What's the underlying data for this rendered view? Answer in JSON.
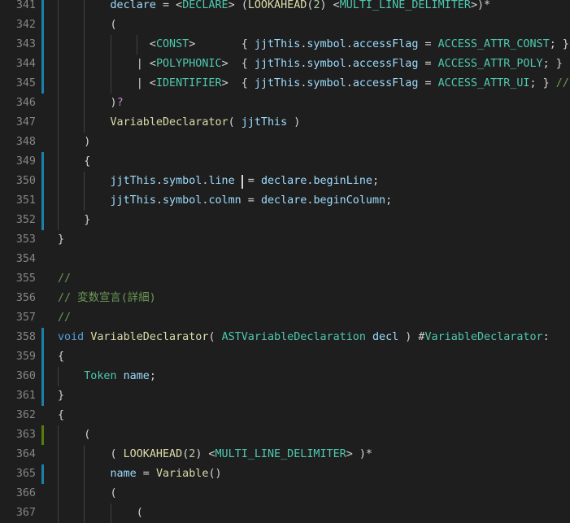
{
  "editor": {
    "theme": {
      "background": "#1e1e1e",
      "line_number": "#858585",
      "gutter_modified": "#1b81a8",
      "gutter_added": "#587c0c",
      "indent_guide": "#404040",
      "cursor": "#d4d4d4"
    },
    "token_colors": {
      "k": "#569cd6",
      "f": "#dcdcaa",
      "t": "#4ec9b0",
      "v": "#9cdcfe",
      "c": "#6a9955",
      "n": "#b5cea8",
      "p": "#d4d4d4",
      "m": "#c586c0"
    },
    "lines": [
      {
        "num": "341",
        "gutter": "mod",
        "segs": [
          [
            "p",
            "        "
          ],
          [
            "v",
            "declare"
          ],
          [
            "p",
            " = <"
          ],
          [
            "t",
            "DECLARE"
          ],
          [
            "p",
            "> ("
          ],
          [
            "f",
            "LOOKAHEAD"
          ],
          [
            "p",
            "("
          ],
          [
            "n",
            "2"
          ],
          [
            "p",
            ") <"
          ],
          [
            "t",
            "MULTI_LINE_DELIMITER"
          ],
          [
            "p",
            ">)*"
          ]
        ]
      },
      {
        "num": "342",
        "gutter": "mod",
        "segs": [
          [
            "p",
            "        ("
          ]
        ]
      },
      {
        "num": "343",
        "gutter": "mod",
        "segs": [
          [
            "p",
            "              <"
          ],
          [
            "t",
            "CONST"
          ],
          [
            "p",
            ">       { "
          ],
          [
            "v",
            "jjtThis"
          ],
          [
            "p",
            "."
          ],
          [
            "v",
            "symbol"
          ],
          [
            "p",
            "."
          ],
          [
            "v",
            "accessFlag"
          ],
          [
            "p",
            " = "
          ],
          [
            "t",
            "ACCESS_ATTR_CONST"
          ],
          [
            "p",
            "; }"
          ]
        ]
      },
      {
        "num": "344",
        "gutter": "mod",
        "segs": [
          [
            "p",
            "            | <"
          ],
          [
            "t",
            "POLYPHONIC"
          ],
          [
            "p",
            ">  { "
          ],
          [
            "v",
            "jjtThis"
          ],
          [
            "p",
            "."
          ],
          [
            "v",
            "symbol"
          ],
          [
            "p",
            "."
          ],
          [
            "v",
            "accessFlag"
          ],
          [
            "p",
            " = "
          ],
          [
            "t",
            "ACCESS_ATTR_POLY"
          ],
          [
            "p",
            "; }"
          ]
        ]
      },
      {
        "num": "345",
        "gutter": "mod",
        "segs": [
          [
            "p",
            "            | <"
          ],
          [
            "t",
            "IDENTIFIER"
          ],
          [
            "p",
            ">  { "
          ],
          [
            "v",
            "jjtThis"
          ],
          [
            "p",
            "."
          ],
          [
            "v",
            "symbol"
          ],
          [
            "p",
            "."
          ],
          [
            "v",
            "accessFlag"
          ],
          [
            "p",
            " = "
          ],
          [
            "t",
            "ACCESS_ATTR_UI"
          ],
          [
            "p",
            "; } "
          ],
          [
            "c",
            "//"
          ]
        ]
      },
      {
        "num": "346",
        "gutter": "",
        "segs": [
          [
            "p",
            "        )"
          ],
          [
            "m",
            "?"
          ]
        ]
      },
      {
        "num": "347",
        "gutter": "",
        "segs": [
          [
            "p",
            "        "
          ],
          [
            "f",
            "VariableDeclarator"
          ],
          [
            "p",
            "( "
          ],
          [
            "v",
            "jjtThis"
          ],
          [
            "p",
            " )"
          ]
        ]
      },
      {
        "num": "348",
        "gutter": "",
        "segs": [
          [
            "p",
            "    )"
          ]
        ]
      },
      {
        "num": "349",
        "gutter": "mod",
        "segs": [
          [
            "p",
            "    {"
          ]
        ]
      },
      {
        "num": "350",
        "gutter": "mod",
        "segs": [
          [
            "p",
            "        "
          ],
          [
            "v",
            "jjtThis"
          ],
          [
            "p",
            "."
          ],
          [
            "v",
            "symbol"
          ],
          [
            "p",
            "."
          ],
          [
            "v",
            "line"
          ],
          [
            "p",
            "  = "
          ],
          [
            "v",
            "declare"
          ],
          [
            "p",
            "."
          ],
          [
            "v",
            "beginLine"
          ],
          [
            "p",
            ";"
          ]
        ]
      },
      {
        "num": "351",
        "gutter": "mod",
        "segs": [
          [
            "p",
            "        "
          ],
          [
            "v",
            "jjtThis"
          ],
          [
            "p",
            "."
          ],
          [
            "v",
            "symbol"
          ],
          [
            "p",
            "."
          ],
          [
            "v",
            "colmn"
          ],
          [
            "p",
            " = "
          ],
          [
            "v",
            "declare"
          ],
          [
            "p",
            "."
          ],
          [
            "v",
            "beginColumn"
          ],
          [
            "p",
            ";"
          ]
        ]
      },
      {
        "num": "352",
        "gutter": "mod",
        "segs": [
          [
            "p",
            "    }"
          ]
        ]
      },
      {
        "num": "353",
        "gutter": "",
        "segs": [
          [
            "p",
            "}"
          ]
        ]
      },
      {
        "num": "354",
        "gutter": "",
        "segs": []
      },
      {
        "num": "355",
        "gutter": "",
        "segs": [
          [
            "c",
            "//"
          ]
        ]
      },
      {
        "num": "356",
        "gutter": "",
        "segs": [
          [
            "c",
            "// 変数宣言(詳細)"
          ]
        ]
      },
      {
        "num": "357",
        "gutter": "",
        "segs": [
          [
            "c",
            "//"
          ]
        ]
      },
      {
        "num": "358",
        "gutter": "mod",
        "segs": [
          [
            "k",
            "void"
          ],
          [
            "p",
            " "
          ],
          [
            "f",
            "VariableDeclarator"
          ],
          [
            "p",
            "( "
          ],
          [
            "t",
            "ASTVariableDeclaration"
          ],
          [
            "p",
            " "
          ],
          [
            "v",
            "decl"
          ],
          [
            "p",
            " ) #"
          ],
          [
            "t",
            "VariableDeclarator"
          ],
          [
            "p",
            ":"
          ]
        ]
      },
      {
        "num": "359",
        "gutter": "mod",
        "segs": [
          [
            "p",
            "{"
          ]
        ]
      },
      {
        "num": "360",
        "gutter": "mod",
        "segs": [
          [
            "p",
            "    "
          ],
          [
            "t",
            "Token"
          ],
          [
            "p",
            " "
          ],
          [
            "v",
            "name"
          ],
          [
            "p",
            ";"
          ]
        ]
      },
      {
        "num": "361",
        "gutter": "mod",
        "segs": [
          [
            "p",
            "}"
          ]
        ]
      },
      {
        "num": "362",
        "gutter": "",
        "segs": [
          [
            "p",
            "{"
          ]
        ]
      },
      {
        "num": "363",
        "gutter": "add",
        "segs": [
          [
            "p",
            "    ("
          ]
        ]
      },
      {
        "num": "364",
        "gutter": "",
        "segs": [
          [
            "p",
            "        ( "
          ],
          [
            "f",
            "LOOKAHEAD"
          ],
          [
            "p",
            "("
          ],
          [
            "n",
            "2"
          ],
          [
            "p",
            ") <"
          ],
          [
            "t",
            "MULTI_LINE_DELIMITER"
          ],
          [
            "p",
            "> )*"
          ]
        ]
      },
      {
        "num": "365",
        "gutter": "mod",
        "segs": [
          [
            "p",
            "        "
          ],
          [
            "v",
            "name"
          ],
          [
            "p",
            " = "
          ],
          [
            "f",
            "Variable"
          ],
          [
            "p",
            "()"
          ]
        ]
      },
      {
        "num": "366",
        "gutter": "",
        "segs": [
          [
            "p",
            "        ("
          ]
        ]
      },
      {
        "num": "367",
        "gutter": "",
        "segs": [
          [
            "p",
            "            ("
          ]
        ]
      }
    ]
  }
}
